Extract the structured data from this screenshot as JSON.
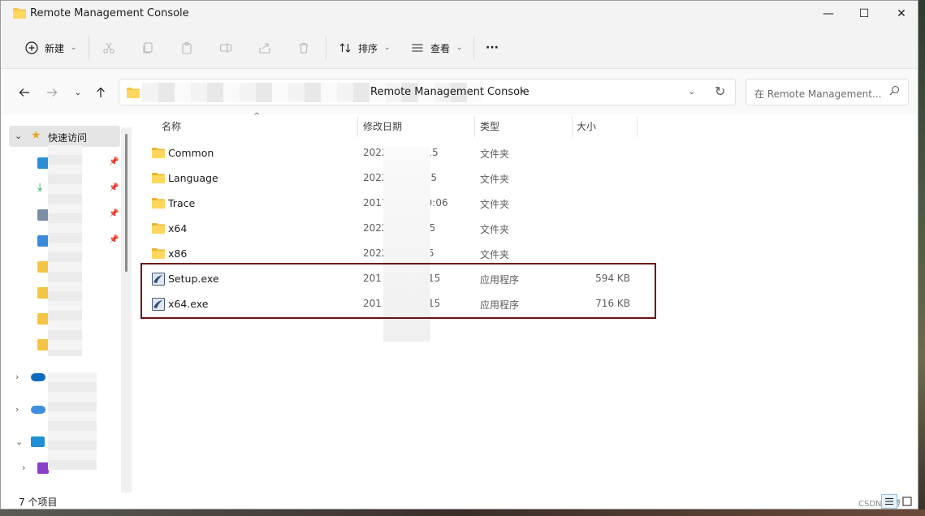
{
  "window": {
    "title": "Remote Management Console",
    "controls": {
      "minimize": "—",
      "maximize": "☐",
      "close": "✕"
    }
  },
  "toolbar": {
    "new_label": "新建",
    "sort_label": "排序",
    "view_label": "查看",
    "more_label": "···"
  },
  "address": {
    "current_folder": "Remote Management Console",
    "separator": "›"
  },
  "search": {
    "placeholder": "在 Remote Management..."
  },
  "sidebar": {
    "quick_access_label": "快速访问"
  },
  "columns": {
    "name": "名称",
    "date": "修改日期",
    "type": "类型",
    "size": "大小"
  },
  "files": [
    {
      "name": "Common",
      "date_prefix": "2022",
      "date_suffix": "15:15",
      "type": "文件夹",
      "size": "",
      "kind": "folder"
    },
    {
      "name": "Language",
      "date_prefix": "2022",
      "date_suffix": "5:15",
      "type": "文件夹",
      "size": "",
      "kind": "folder"
    },
    {
      "name": "Trace",
      "date_prefix": "2017",
      "date_suffix": "10:06",
      "type": "文件夹",
      "size": "",
      "kind": "folder"
    },
    {
      "name": "x64",
      "date_prefix": "2022",
      "date_suffix": "15",
      "type": "文件夹",
      "size": "",
      "kind": "folder"
    },
    {
      "name": "x86",
      "date_prefix": "2022",
      "date_suffix": "5",
      "type": "文件夹",
      "size": "",
      "kind": "folder"
    },
    {
      "name": "Setup.exe",
      "date_prefix": "201",
      "date_suffix": "15",
      "type": "应用程序",
      "size": "594 KB",
      "kind": "exe"
    },
    {
      "name": "x64.exe",
      "date_prefix": "201",
      "date_suffix": "15",
      "type": "应用程序",
      "size": "716 KB",
      "kind": "exe"
    }
  ],
  "status": {
    "item_count": "7 个项目",
    "watermark": "CSDN @博"
  },
  "colors": {
    "highlight_border": "#6b0f12",
    "folder_yellow": "#f4c542",
    "quick_access_bg": "#e5e5e5"
  }
}
